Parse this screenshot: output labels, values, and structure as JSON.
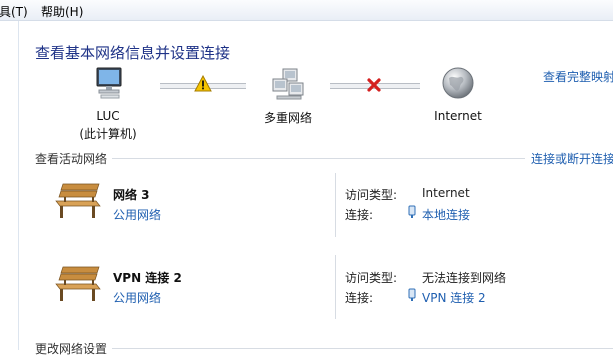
{
  "menu": {
    "tools_label": "具(T)",
    "help_label": "帮助(H)"
  },
  "page_title": "查看基本网络信息并设置连接",
  "full_map_link": "查看完整映射",
  "map": {
    "computer": {
      "name": "LUC",
      "note": "(此计算机)"
    },
    "multiple_networks": "多重网络",
    "internet": "Internet"
  },
  "active_networks": {
    "title": "查看活动网络",
    "link": "连接或断开连接",
    "networks": [
      {
        "name": "网络  3",
        "type": "公用网络",
        "access_label": "访问类型:",
        "access_value": "Internet",
        "connection_label": "连接:",
        "connection_value": "本地连接"
      },
      {
        "name": "VPN 连接 2",
        "type": "公用网络",
        "access_label": "访问类型:",
        "access_value": "无法连接到网络",
        "connection_label": "连接:",
        "connection_value": "VPN 连接 2"
      }
    ]
  },
  "change_settings": {
    "title": "更改网络设置"
  },
  "colors": {
    "link": "#1f5fb0",
    "title": "#1e3287",
    "warning": "#f5c400",
    "error": "#d42020"
  }
}
